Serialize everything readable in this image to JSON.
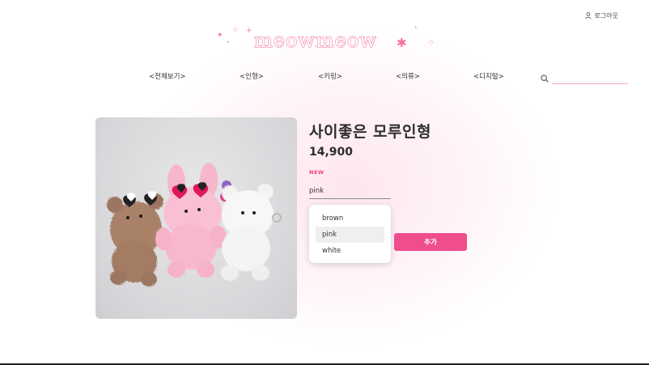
{
  "header": {
    "logout_label": "로그아웃",
    "logo_text": "meowmeow"
  },
  "nav": {
    "items": [
      {
        "label": "<전체보기>"
      },
      {
        "label": "<인형>"
      },
      {
        "label": "<키링>"
      },
      {
        "label": "<의류>"
      },
      {
        "label": "<디지털>"
      }
    ],
    "search_placeholder": ""
  },
  "product": {
    "title": "사이좋은 모루인형",
    "price": "14,900",
    "badge": "NEW",
    "selected_option": "pink",
    "options": [
      {
        "label": "brown"
      },
      {
        "label": "pink"
      },
      {
        "label": "white"
      }
    ],
    "add_button": "추가",
    "image_icon": "bear-plush-trio-image"
  },
  "colors": {
    "accent": "#f04d8c",
    "logo_outline": "#f06a9c",
    "badge": "#f03f7b"
  }
}
